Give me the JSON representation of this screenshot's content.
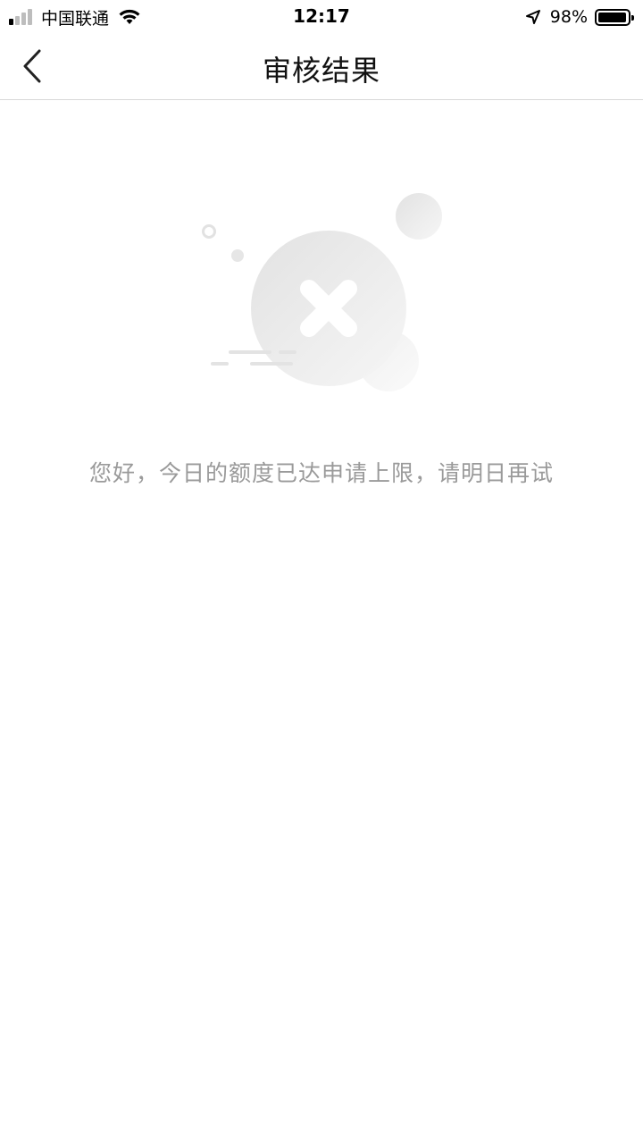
{
  "status_bar": {
    "carrier": "中国联通",
    "time": "12:17",
    "battery_percent": "98%",
    "battery_level": 0.98,
    "signal_bars_active": 1,
    "signal_bars_total": 4
  },
  "nav": {
    "title": "审核结果",
    "back_icon": "chevron-left-icon"
  },
  "result": {
    "icon": "close-x-icon",
    "message": "您好，今日的额度已达申请上限，请明日再试"
  },
  "colors": {
    "title_text": "#111111",
    "message_text": "#9a9a9a",
    "divider": "#d8d8d8",
    "illustration_gray": "#e6e6e6"
  }
}
